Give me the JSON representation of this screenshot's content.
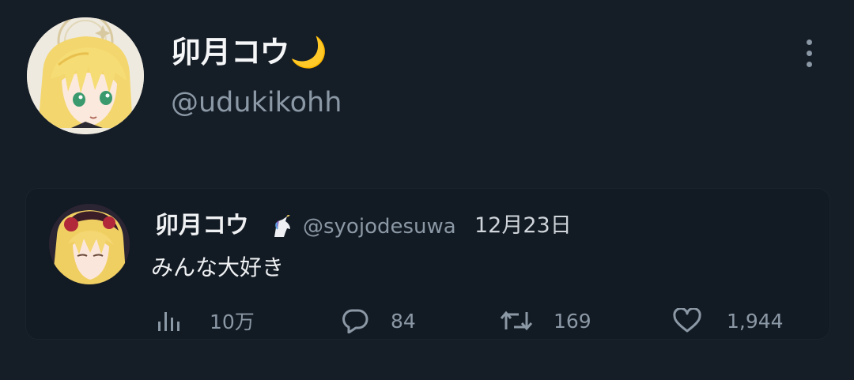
{
  "header": {
    "display_name": "卯月コウ",
    "display_name_emoji": "🌙",
    "handle": "@udukikohh",
    "more_icon": "more-vertical-icon"
  },
  "quoted_tweet": {
    "display_name": "卯月コウ",
    "name_emoji": "🦄",
    "handle": "@syojodesuwa",
    "date": "12月23日",
    "text": "みんな大好き",
    "metrics": {
      "views": "10万",
      "replies": "84",
      "retweets": "169",
      "likes": "1,944"
    }
  },
  "colors": {
    "background": "#151d27",
    "muted_text": "#8b98a5",
    "primary_text": "#eef0f2"
  }
}
